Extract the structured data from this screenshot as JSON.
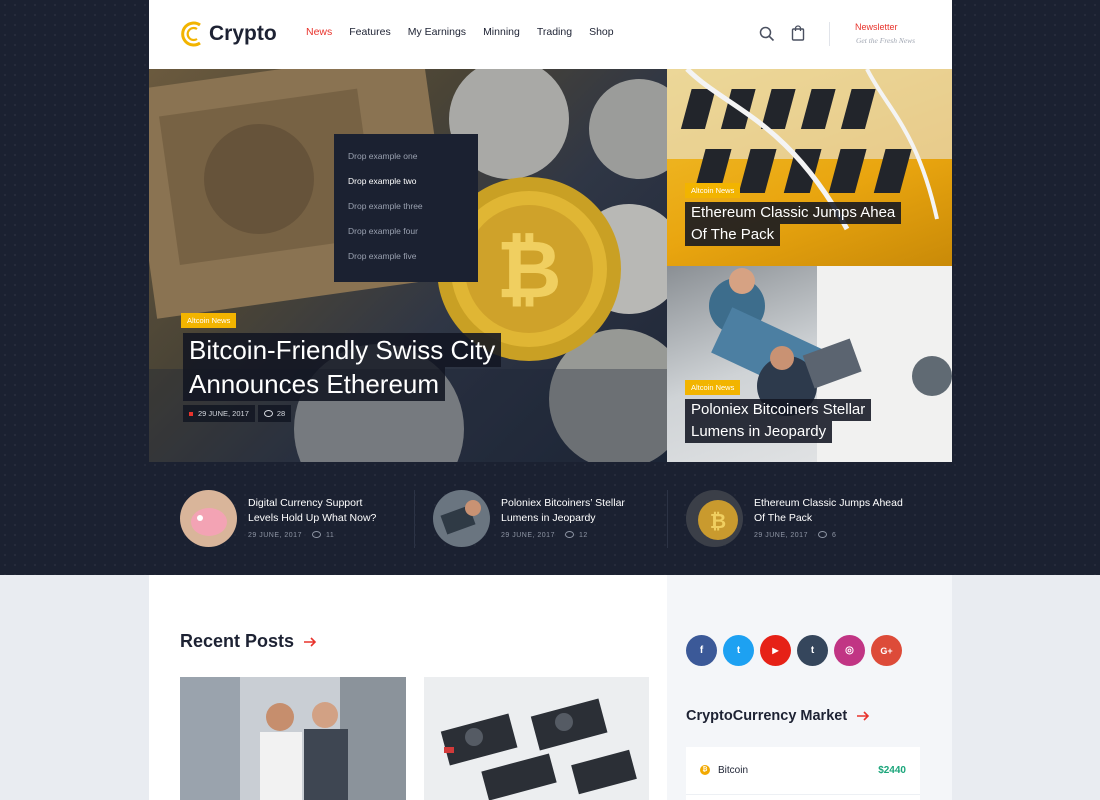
{
  "brand": {
    "name": "Crypto"
  },
  "nav": {
    "items": [
      "News",
      "Features",
      "My Earnings",
      "Minning",
      "Trading",
      "Shop"
    ],
    "active": "News"
  },
  "header": {
    "newsletter_title": "Newsletter",
    "newsletter_sub": "Get the Fresh News"
  },
  "dropdown": {
    "items": [
      "Drop example one",
      "Drop example two",
      "Drop example three",
      "Drop example four",
      "Drop example five"
    ],
    "selected": "Drop example two"
  },
  "hero": {
    "main": {
      "badge": "Altcoin News",
      "title_line1": "Bitcoin-Friendly Swiss City",
      "title_line2": "Announces Ethereum",
      "date": "29 JUNE, 2017",
      "comments": "28"
    },
    "side_top": {
      "badge": "Altcoin News",
      "title_line1": "Ethereum Classic Jumps Ahea",
      "title_line2": "Of The Pack"
    },
    "side_bottom": {
      "badge": "Altcoin News",
      "title_line1": "Poloniex Bitcoiners Stellar",
      "title_line2": "Lumens in Jeopardy"
    }
  },
  "featured": [
    {
      "title_line1": "Digital Currency Support",
      "title_line2": "Levels Hold Up What Now?",
      "date": "29 JUNE, 2017",
      "comments": "11"
    },
    {
      "title_line1": "Poloniex Bitcoiners’ Stellar",
      "title_line2": "Lumens in Jeopardy",
      "date": "29 JUNE, 2017",
      "comments": "12"
    },
    {
      "title_line1": "Ethereum Classic Jumps Ahead",
      "title_line2": "Of The Pack",
      "date": "29 JUNE, 2017",
      "comments": "6"
    }
  ],
  "recent_posts": {
    "title": "Recent Posts"
  },
  "social": [
    {
      "icon": "facebook-icon",
      "glyph": "f",
      "color": "#3b5998"
    },
    {
      "icon": "twitter-icon",
      "glyph": "t",
      "color": "#1da1f2"
    },
    {
      "icon": "youtube-icon",
      "glyph": "▶",
      "color": "#e62117"
    },
    {
      "icon": "tumblr-icon",
      "glyph": "t",
      "color": "#35465c"
    },
    {
      "icon": "instagram-icon",
      "glyph": "◎",
      "color": "#c13584"
    },
    {
      "icon": "google-plus-icon",
      "glyph": "G+",
      "color": "#dd4b39"
    }
  ],
  "market": {
    "title": "CryptoCurrency Market",
    "rows": [
      {
        "name": "Bitcoin",
        "price": "$2440"
      }
    ]
  },
  "colors": {
    "accent": "#e8332c",
    "badge": "#f2b400",
    "dark": "#1b2131",
    "price": "#1aa57a"
  }
}
